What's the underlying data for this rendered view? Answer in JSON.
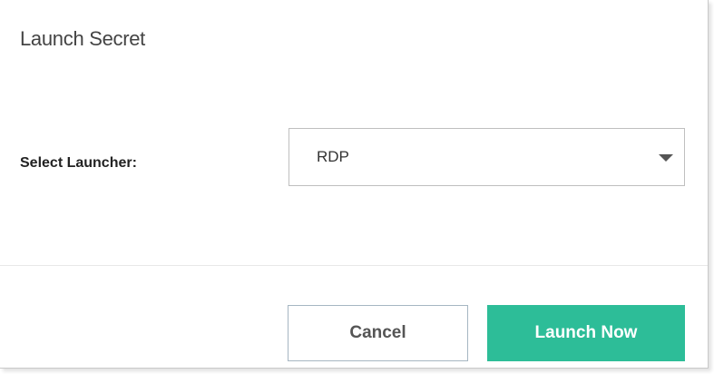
{
  "dialog": {
    "title": "Launch Secret",
    "launcher_label": "Select Launcher:",
    "launcher_selected": "RDP",
    "cancel_label": "Cancel",
    "launch_label": "Launch Now"
  },
  "colors": {
    "primary": "#2dbd98",
    "title_text": "#444444",
    "border": "#bfbfbf"
  },
  "icons": {
    "dropdown": "caret-down-icon"
  }
}
